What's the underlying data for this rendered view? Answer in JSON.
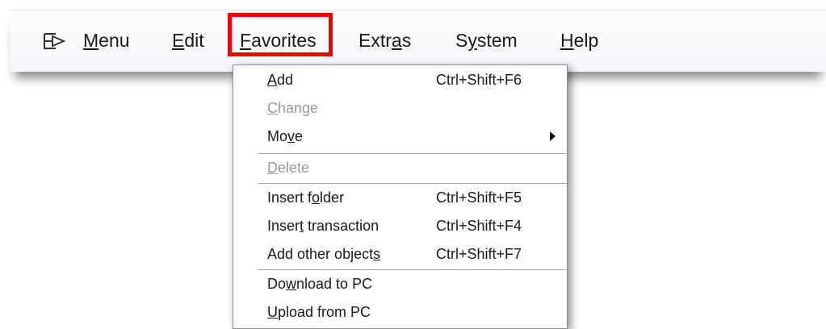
{
  "menubar": {
    "items": [
      {
        "pre": "",
        "key": "M",
        "post": "enu"
      },
      {
        "pre": "",
        "key": "E",
        "post": "dit"
      },
      {
        "pre": "",
        "key": "F",
        "post": "avorites"
      },
      {
        "pre": "Extr",
        "key": "a",
        "post": "s"
      },
      {
        "pre": "S",
        "key": "y",
        "post": "stem"
      },
      {
        "pre": "",
        "key": "H",
        "post": "elp"
      }
    ],
    "system_icon": "system-menu-icon"
  },
  "favorites_menu": {
    "items": [
      {
        "pre": "",
        "key": "A",
        "post": "dd",
        "shortcut": "Ctrl+Shift+F6",
        "disabled": false
      },
      {
        "pre": "",
        "key": "C",
        "post": "hange",
        "shortcut": "",
        "disabled": true
      },
      {
        "pre": "Mo",
        "key": "v",
        "post": "e",
        "shortcut": "",
        "disabled": false,
        "submenu": true
      },
      {
        "pre": "",
        "key": "D",
        "post": "elete",
        "shortcut": "",
        "disabled": true
      },
      {
        "pre": "Insert f",
        "key": "o",
        "post": "lder",
        "shortcut": "Ctrl+Shift+F5",
        "disabled": false
      },
      {
        "pre": "Inser",
        "key": "t",
        "post": " transaction",
        "shortcut": "Ctrl+Shift+F4",
        "disabled": false
      },
      {
        "pre": "Add other object",
        "key": "s",
        "post": "",
        "shortcut": "Ctrl+Shift+F7",
        "disabled": false
      },
      {
        "pre": "Do",
        "key": "w",
        "post": "nload to PC",
        "shortcut": "",
        "disabled": false
      },
      {
        "pre": "",
        "key": "U",
        "post": "pload from PC",
        "shortcut": "",
        "disabled": false
      }
    ]
  },
  "colors": {
    "highlight": "#ee0000",
    "disabled_text": "#9a9a9a"
  }
}
